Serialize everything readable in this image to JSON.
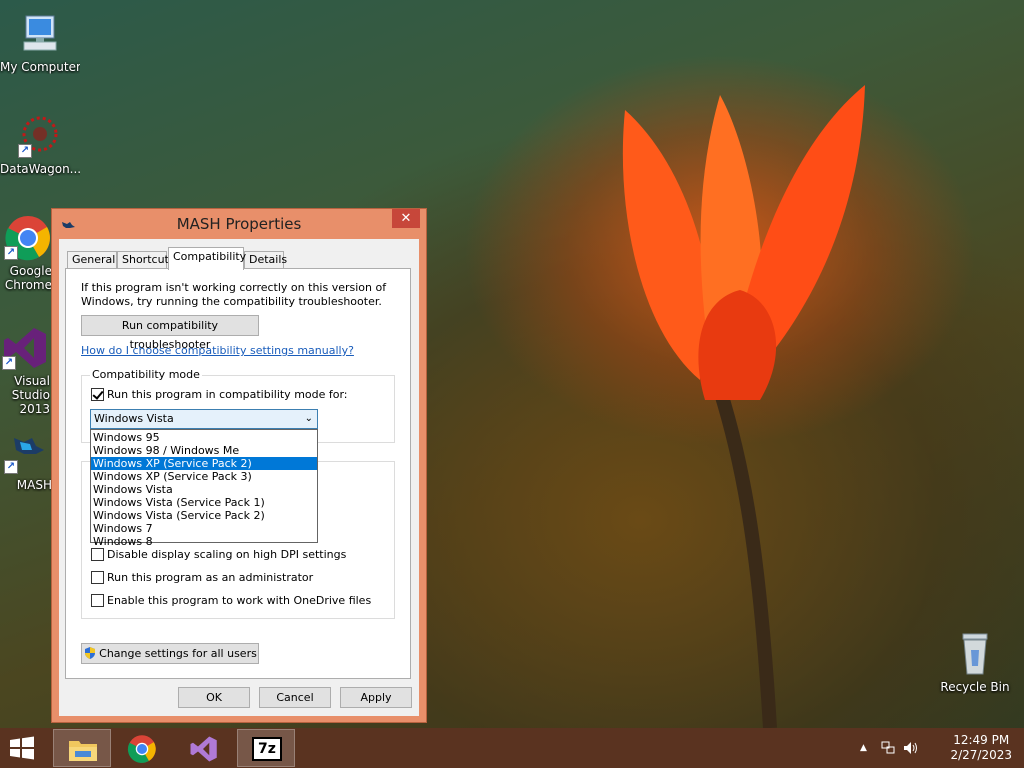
{
  "desktop": {
    "icons": [
      {
        "label": "My Computer"
      },
      {
        "label": "DataWagon..."
      },
      {
        "label": "Google Chrome"
      },
      {
        "label": "Visual Studio 2013"
      },
      {
        "label": "MASH"
      },
      {
        "label": "Recycle Bin"
      }
    ]
  },
  "window": {
    "title": "MASH Properties",
    "close_label": "✕",
    "tabs": [
      {
        "label": "General"
      },
      {
        "label": "Shortcut"
      },
      {
        "label": "Compatibility"
      },
      {
        "label": "Details"
      }
    ],
    "intro_text": "If this program isn't working correctly on this version of Windows, try running the compatibility troubleshooter.",
    "troubleshooter_button": "Run compatibility troubleshooter",
    "manual_link": "How do I choose compatibility settings manually?",
    "compat_group_label": "Compatibility mode",
    "compat_checkbox_label": "Run this program in compatibility mode for:",
    "selected_os": "Windows Vista",
    "os_options": [
      "Windows 95",
      "Windows 98 / Windows Me",
      "Windows XP (Service Pack 2)",
      "Windows XP (Service Pack 3)",
      "Windows Vista",
      "Windows Vista (Service Pack 1)",
      "Windows Vista (Service Pack 2)",
      "Windows 7",
      "Windows 8"
    ],
    "settings_checkboxes": [
      {
        "label": "Disable display scaling on high DPI settings"
      },
      {
        "label": "Run this program as an administrator"
      },
      {
        "label": "Enable this program to work with OneDrive files"
      }
    ],
    "all_users_button": "Change settings for all users",
    "ok_button": "OK",
    "cancel_button": "Cancel",
    "apply_button": "Apply"
  },
  "taskbar": {
    "apps": [
      {
        "name": "File Explorer"
      },
      {
        "name": "Google Chrome"
      },
      {
        "name": "Visual Studio"
      },
      {
        "name": "7-Zip",
        "glyph": "7z"
      }
    ],
    "time": "12:49 PM",
    "date": "2/27/2023"
  },
  "colors": {
    "title_bar": "#e88f6a",
    "close_button": "#c7473a",
    "selection": "#0078d7",
    "link": "#1a5dbb",
    "taskbar": "#5a3320"
  }
}
